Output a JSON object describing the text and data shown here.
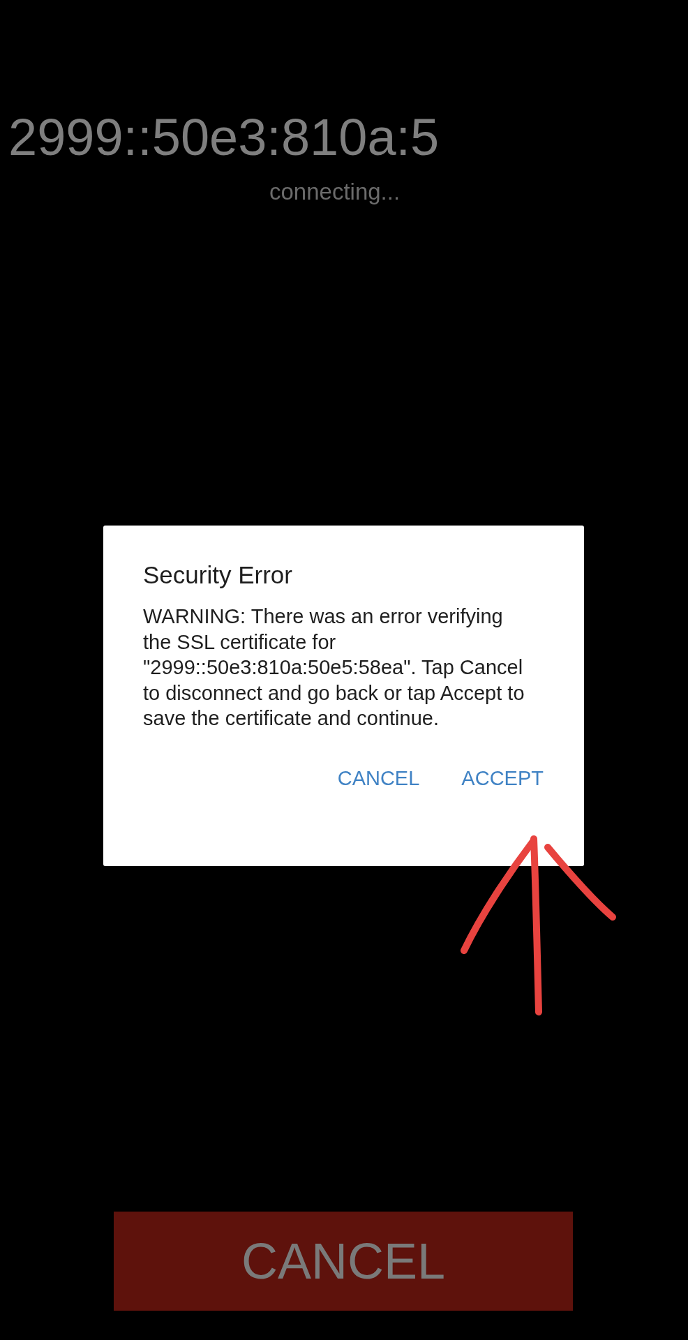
{
  "host": {
    "address": "2999::50e3:810a:5",
    "status": "connecting..."
  },
  "dialog": {
    "title": "Security Error",
    "message": "WARNING: There was an error verifying the SSL certificate for \"2999::50e3:810a:50e5:58ea\". Tap Cancel to disconnect and go back or tap Accept to save the certificate and continue.",
    "buttons": [
      {
        "label": "CANCEL"
      },
      {
        "label": "ACCEPT"
      }
    ]
  },
  "cancel_button": {
    "label": "CANCEL"
  }
}
